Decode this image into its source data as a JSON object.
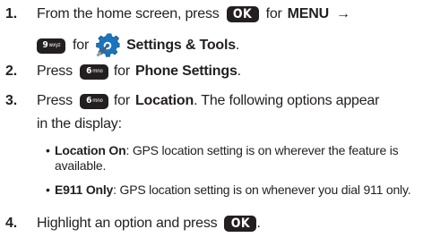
{
  "steps": [
    {
      "number": "1.",
      "line1_before_key": "From the home screen, press",
      "key_ok": "OK",
      "line1_for": "for",
      "menu_label": "MENU",
      "arrow": "→",
      "key9_big": "9",
      "key9_small": "wxyz",
      "line2_for": "for",
      "settings_label": "Settings & Tools",
      "line2_end": "."
    },
    {
      "number": "2.",
      "before_key": "Press",
      "key6_big": "6",
      "key6_small": "mno",
      "for": "for",
      "target": "Phone Settings",
      "end": "."
    },
    {
      "number": "3.",
      "before_key": "Press",
      "key6_big": "6",
      "key6_small": "mno",
      "for": "for",
      "target": "Location",
      "after": ". The following options appear",
      "line2": "in the display:"
    },
    {
      "number": "4.",
      "before_key": "Highlight an option and press",
      "key_ok": "OK",
      "end": "."
    }
  ],
  "bullets": [
    {
      "dot": "•",
      "term": "Location On",
      "desc_line1": ": GPS location setting is on wherever the feature is",
      "desc_line2": "available."
    },
    {
      "dot": "•",
      "term": "E911 Only",
      "desc_line1": ": GPS location setting is on whenever you dial 911 only."
    }
  ],
  "icons": {
    "settings": "gear-icon"
  },
  "colors": {
    "text": "#231f20",
    "key_bg": "#231f20",
    "gear_blue": "#1b75bc"
  }
}
